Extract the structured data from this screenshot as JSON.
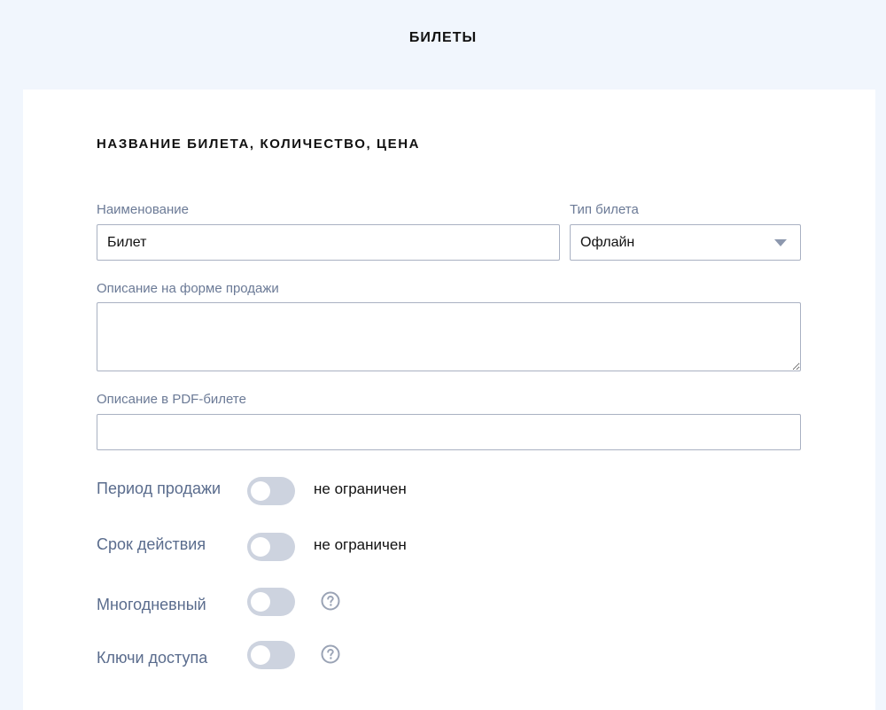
{
  "page": {
    "title": "БИЛЕТЫ"
  },
  "section": {
    "title": "НАЗВАНИЕ БИЛЕТА, КОЛИЧЕСТВО, ЦЕНА"
  },
  "form": {
    "name": {
      "label": "Наименование",
      "value": "Билет"
    },
    "ticket_type": {
      "label": "Тип билета",
      "value": "Офлайн"
    },
    "sale_description": {
      "label": "Описание на форме продажи",
      "value": ""
    },
    "pdf_description": {
      "label": "Описание в PDF-билете",
      "value": ""
    }
  },
  "toggles": [
    {
      "label": "Период продажи",
      "enabled": false,
      "value": "не ограничен"
    },
    {
      "label": "Срок действия",
      "enabled": false,
      "value": "не ограничен"
    },
    {
      "label": "Многодневный",
      "enabled": false,
      "icon": "help-icon"
    },
    {
      "label": "Ключи доступа",
      "enabled": false,
      "icon": "help-icon"
    }
  ],
  "colors": {
    "background": "#f1f6fd",
    "card": "#ffffff",
    "label": "#6b7a96",
    "toggle_off": "#cdd3df",
    "icon": "#9aa3b5"
  }
}
